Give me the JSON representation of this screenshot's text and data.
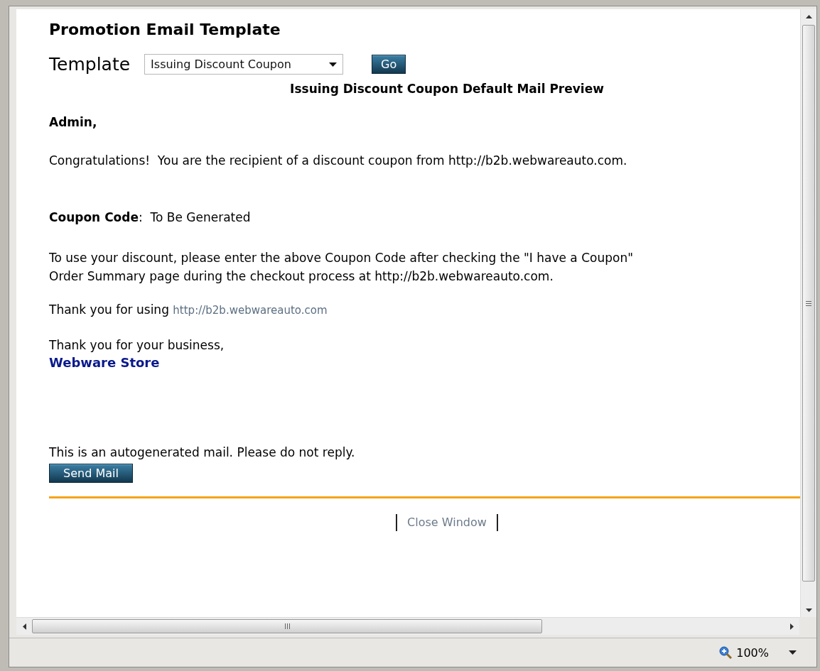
{
  "page_title": "Promotion Email Template",
  "template_field": {
    "label": "Template",
    "value": "Issuing Discount Coupon",
    "button": "Go"
  },
  "preview": {
    "heading": "Issuing Discount Coupon Default Mail Preview",
    "greeting": "Admin,",
    "intro": "Congratulations!  You are the recipient of a discount coupon from http://b2b.webwareauto.com.",
    "coupon_line": "**Coupon Code**:  To Be Generated",
    "instructions": [
      "To use your discount, please enter the above Coupon Code after checking the \"I have a Coupon\"",
      "Order Summary page during the checkout process at http://b2b.webwareauto.com."
    ],
    "thanks_prefix": "Thank you for using",
    "thanks_link": "http://b2b.webwareauto.com",
    "closing": "Thank you for your business,",
    "signature": "Webware Store",
    "notice": "This is an autogenerated mail. Please do not reply."
  },
  "send_button": "Send Mail",
  "close_link": "Close Window",
  "status_bar": {
    "zoom": "100%"
  }
}
